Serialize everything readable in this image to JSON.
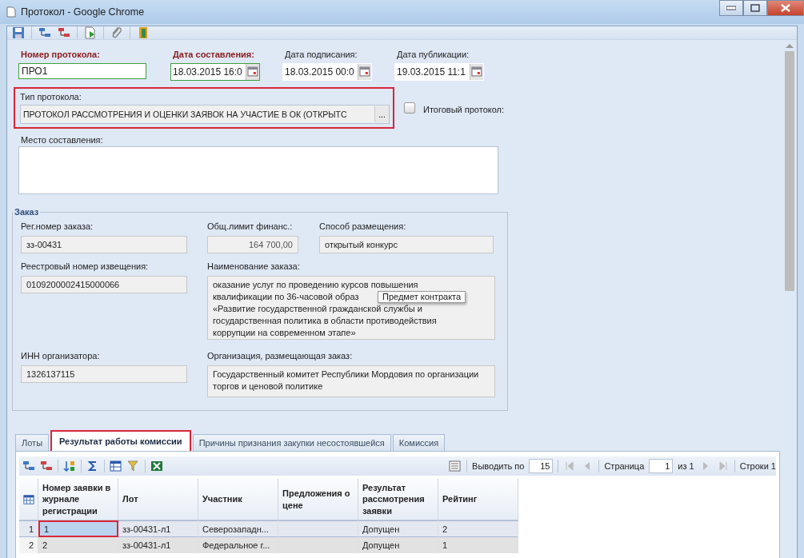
{
  "window": {
    "title": "Протокол - Google Chrome"
  },
  "header_fields": [
    {
      "label": "Номер протокола:",
      "value": "ПРО1",
      "required": true,
      "kind": "text"
    },
    {
      "label": "Дата составления:",
      "value": "18.03.2015 16:0",
      "required": true,
      "kind": "date"
    },
    {
      "label": "Дата подписания:",
      "value": "18.03.2015 00:0",
      "required": false,
      "kind": "date"
    },
    {
      "label": "Дата публикации:",
      "value": "19.03.2015 11:1",
      "required": false,
      "kind": "date"
    }
  ],
  "protocol_type": {
    "label": "Тип протокола:",
    "value": "ПРОТОКОЛ РАССМОТРЕНИЯ И ОЦЕНКИ ЗАЯВОК НА УЧАСТИЕ В ОК (ОТКРЫТС",
    "browse": "...",
    "highlighted": true
  },
  "final_protocol": {
    "label": "Итоговый протокол:",
    "checked": false
  },
  "place": {
    "label": "Место составления:"
  },
  "order": {
    "title": "Заказ",
    "tooltip": "Предмет контракта",
    "rows": [
      {
        "fields": [
          {
            "label": "Рег.номер заказа:",
            "value": "зз-00431",
            "kind": "text"
          },
          {
            "label": "Общ.лимит финанс.:",
            "value": "164 700,00",
            "kind": "amount"
          },
          {
            "label": "Способ размещения:",
            "value": "открытый конкурс",
            "kind": "text"
          }
        ]
      },
      {
        "fields": [
          {
            "label": "Реестровый номер извещения:",
            "value": "0109200002415000066",
            "kind": "text"
          },
          {
            "label": "Наименование заказа:",
            "lines": [
              "оказание услуг по проведению курсов повышения",
              "квалификации по 36-часовой образ",
              "«Развитие государственной гражданской службы и",
              "государственная политика в области противодействия",
              "коррупции на современном этапе»"
            ],
            "kind": "memo"
          }
        ]
      },
      {
        "fields": [
          {
            "label": "ИНН организатора:",
            "value": "1326137115",
            "kind": "text"
          },
          {
            "label": "Организация, размещающая заказ:",
            "value": "Государственный комитет Республики Мордовия по организации торгов и ценовой политике",
            "kind": "memo"
          }
        ]
      }
    ]
  },
  "tabs": [
    {
      "label": "Лоты",
      "selected": false,
      "highlighted": false
    },
    {
      "label": "Результат работы комиссии",
      "selected": true,
      "highlighted": true
    },
    {
      "label": "Причины признания закупки несостоявшейся",
      "selected": false,
      "highlighted": false
    },
    {
      "label": "Комиссия",
      "selected": false,
      "highlighted": false
    }
  ],
  "pager": {
    "page_size_label": "Выводить по",
    "page_size": "15",
    "page_label": "Страница",
    "page": "1",
    "page_total": "из 1",
    "rows_label": "Строки 1"
  },
  "table": {
    "columns": [
      "Номер заявки в журнале регистрации",
      "Лот",
      "Участник",
      "Предложения о цене",
      "Результат рассмотрения заявки",
      "Рейтинг"
    ],
    "rows": [
      {
        "number": "1",
        "cells": [
          "1",
          "зз-00431-л1",
          "Северозападн...",
          null,
          "Допущен",
          "2"
        ],
        "selected": true,
        "highlighted": true
      },
      {
        "number": "2",
        "cells": [
          "2",
          "зз-00431-л1",
          "Федеральное г...",
          null,
          "Допущен",
          "1"
        ],
        "selected": false,
        "highlighted": false
      }
    ]
  }
}
